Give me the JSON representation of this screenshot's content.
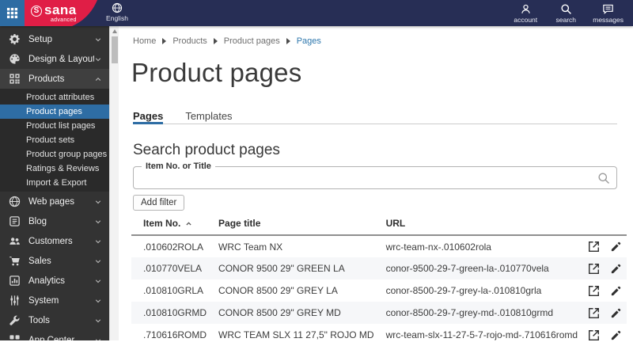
{
  "topbar": {
    "logo": {
      "brand": "sana",
      "sub": "advanced"
    },
    "language": {
      "label": "English"
    },
    "actions": [
      {
        "label": "account",
        "icon": "person"
      },
      {
        "label": "search",
        "icon": "magnifier"
      },
      {
        "label": "messages",
        "icon": "chat"
      }
    ]
  },
  "sidebar": {
    "items": [
      {
        "label": "Setup",
        "icon": "gear"
      },
      {
        "label": "Design & Layout",
        "icon": "palette"
      },
      {
        "label": "Products",
        "icon": "products",
        "expanded": true,
        "children": [
          {
            "label": "Product attributes",
            "active": false
          },
          {
            "label": "Product pages",
            "active": true
          },
          {
            "label": "Product list pages",
            "active": false
          },
          {
            "label": "Product sets",
            "active": false
          },
          {
            "label": "Product group pages",
            "active": false
          },
          {
            "label": "Ratings & Reviews",
            "active": false
          },
          {
            "label": "Import & Export",
            "active": false
          }
        ]
      },
      {
        "label": "Web pages",
        "icon": "web"
      },
      {
        "label": "Blog",
        "icon": "blog"
      },
      {
        "label": "Customers",
        "icon": "customers"
      },
      {
        "label": "Sales",
        "icon": "cart"
      },
      {
        "label": "Analytics",
        "icon": "analytics"
      },
      {
        "label": "System",
        "icon": "sliders"
      },
      {
        "label": "Tools",
        "icon": "wrench"
      },
      {
        "label": "App Center",
        "icon": "apps"
      }
    ]
  },
  "breadcrumb": {
    "items": [
      "Home",
      "Products",
      "Product pages",
      "Pages"
    ]
  },
  "page": {
    "title": "Product pages"
  },
  "tabs": [
    {
      "label": "Pages",
      "active": true
    },
    {
      "label": "Templates",
      "active": false
    }
  ],
  "search": {
    "heading": "Search product pages",
    "field_label": "Item No. or Title",
    "value": "",
    "add_filter_label": "Add filter"
  },
  "table": {
    "columns": [
      "Item No.",
      "Page title",
      "URL"
    ],
    "sort": {
      "column": "Item No.",
      "direction": "asc"
    },
    "rows": [
      {
        "item_no": ".010602ROLA",
        "page_title": "WRC Team NX",
        "url": "wrc-team-nx-.010602rola"
      },
      {
        "item_no": ".010770VELA",
        "page_title": "CONOR 9500 29\" GREEN LA",
        "url": "conor-9500-29-7-green-la-.010770vela"
      },
      {
        "item_no": ".010810GRLA",
        "page_title": "CONOR 8500 29\" GREY LA",
        "url": "conor-8500-29-7-grey-la-.010810grla"
      },
      {
        "item_no": ".010810GRMD",
        "page_title": "CONOR 8500 29\" GREY MD",
        "url": "conor-8500-29-7-grey-md-.010810grmd"
      },
      {
        "item_no": ".710616ROMD",
        "page_title": "WRC TEAM SLX 11 27,5\" ROJO MD",
        "url": "wrc-team-slx-11-27-5-7-rojo-md-.710616romd"
      }
    ]
  },
  "colors": {
    "topbar": "#272e55",
    "brand_red": "#e01e46",
    "app_tile_blue": "#2d6ca3",
    "sidebar": "#333333",
    "sidebar_expanded": "#2a2a2a",
    "active_item_blue": "#2e6da4",
    "link_blue": "#2e77ad",
    "tab_underline": "#2e6da4",
    "row_alt": "#f6f7f9"
  }
}
